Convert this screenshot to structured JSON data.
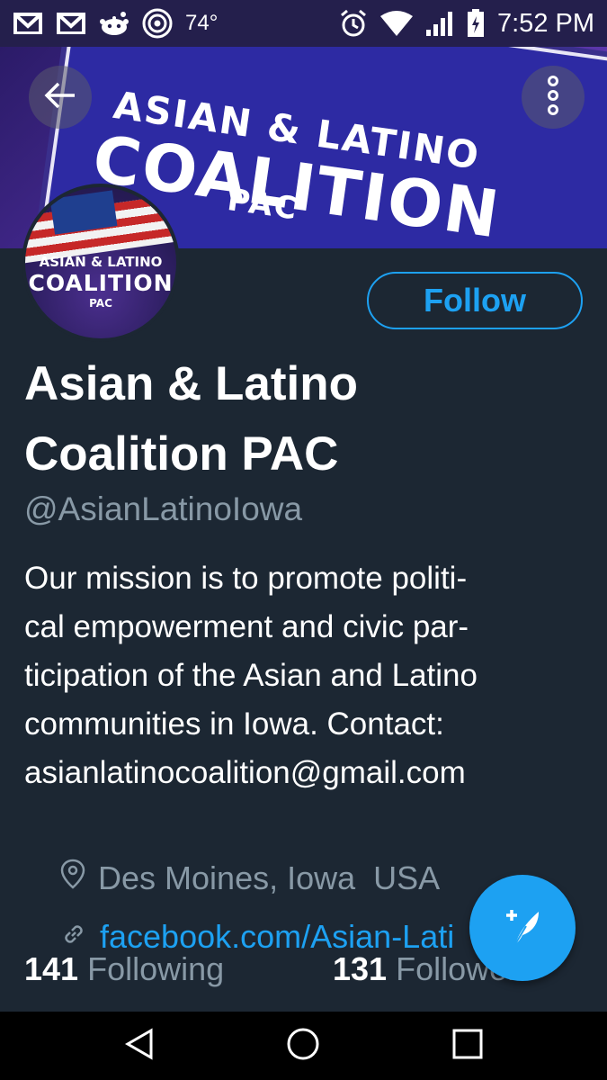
{
  "status_bar": {
    "temperature": "74°",
    "time": "7:52 PM",
    "left_icons": [
      "gmail-icon",
      "gmail-icon",
      "reddit-icon",
      "target-app-icon"
    ],
    "right_icons": [
      "alarm-icon",
      "wifi-icon",
      "signal-icon",
      "battery-charging-icon"
    ]
  },
  "banner": {
    "line1": "ASIAN & LATINO",
    "line2": "COALITION",
    "line3": "PAC"
  },
  "avatar": {
    "line1": "ASIAN & LATINO",
    "line2": "COALITION",
    "line3": "PAC"
  },
  "profile": {
    "follow_label": "Follow",
    "name": "Asian & Latino Coalition PAC",
    "name_line1": "Asian & Latino",
    "name_line2": "Coalition PAC",
    "handle": "@AsianLatinoIowa",
    "bio_lines": [
      "Our mission is to promote politi-",
      "cal empowerment and civic par-",
      "ticipation of the Asian and Latino",
      "communities in Iowa. Contact:",
      "asianlatinocoalition@gmail.com"
    ],
    "location": "Des Moines, Iowa  USA",
    "link": "facebook.com/Asian-Lati",
    "following_count": "141",
    "following_label": "Following",
    "followers_count": "131",
    "followers_label": "Followers"
  },
  "colors": {
    "background": "#1c2733",
    "accent": "#1da1f2",
    "secondary_text": "#8899a6",
    "status_bar": "#241f4c"
  }
}
